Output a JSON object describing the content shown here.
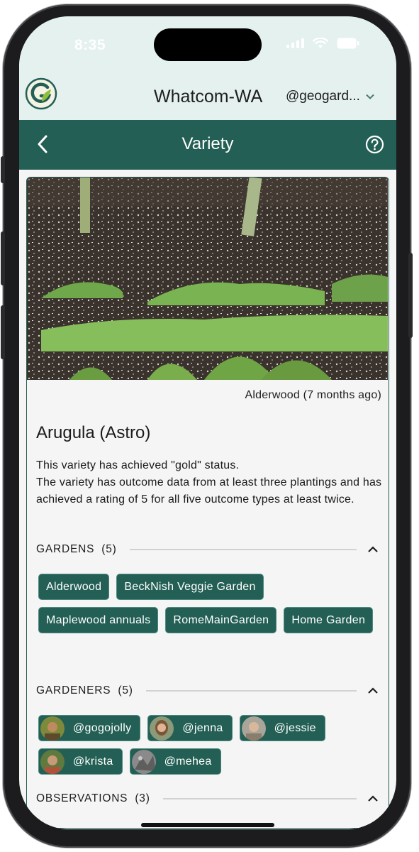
{
  "status_bar": {
    "time": "8:35",
    "icons": [
      "cellular-signal-icon",
      "wifi-icon",
      "battery-icon"
    ]
  },
  "header": {
    "logo": "geogarden-logo",
    "region": "Whatcom-WA",
    "user": "@geogard..."
  },
  "nav": {
    "title": "Variety",
    "back_icon": "chevron-left-icon",
    "help_icon": "help-circle-icon"
  },
  "variety": {
    "photo_caption": "Alderwood (7 months ago)",
    "name": "Arugula (Astro)",
    "status_line1": "This variety has achieved \"gold\" status.",
    "status_line2": "The variety has outcome data from at least three plantings and has achieved a rating of 5 for all five outcome types at least twice."
  },
  "gardens": {
    "title": "GARDENS",
    "count": "(5)",
    "items": [
      "Alderwood",
      "BeckNish Veggie Garden",
      "Maplewood annuals",
      "RomeMainGarden",
      "Home Garden"
    ]
  },
  "gardeners": {
    "title": "GARDENERS",
    "count": "(5)",
    "items": [
      "@gogojolly",
      "@jenna",
      "@jessie",
      "@krista",
      "@mehea"
    ]
  },
  "observations": {
    "title": "OBSERVATIONS",
    "count": "(3)"
  },
  "colors": {
    "primary": "#235f55",
    "header_bg": "#e4f1ef",
    "page_bg": "#f5f5f5"
  }
}
